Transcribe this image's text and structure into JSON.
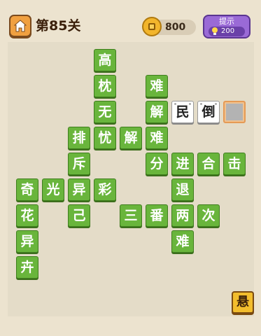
{
  "header": {
    "level_title": "第85关",
    "coins": "800",
    "hint_label": "提示",
    "hint_count": "200"
  },
  "board": {
    "tiles": [
      {
        "char": "高",
        "style": "green"
      },
      {
        "char": "枕",
        "style": "green"
      },
      {
        "char": "难",
        "style": "green"
      },
      {
        "char": "无",
        "style": "green"
      },
      {
        "char": "解",
        "style": "green"
      },
      {
        "char": "民",
        "style": "white"
      },
      {
        "char": "倒",
        "style": "white"
      },
      {
        "char": "",
        "style": "blank"
      },
      {
        "char": "排",
        "style": "green"
      },
      {
        "char": "忧",
        "style": "green"
      },
      {
        "char": "解",
        "style": "green"
      },
      {
        "char": "难",
        "style": "green"
      },
      {
        "char": "斥",
        "style": "green"
      },
      {
        "char": "分",
        "style": "green"
      },
      {
        "char": "进",
        "style": "green"
      },
      {
        "char": "合",
        "style": "green"
      },
      {
        "char": "击",
        "style": "green"
      },
      {
        "char": "奇",
        "style": "green"
      },
      {
        "char": "光",
        "style": "green"
      },
      {
        "char": "异",
        "style": "green"
      },
      {
        "char": "彩",
        "style": "green"
      },
      {
        "char": "退",
        "style": "green"
      },
      {
        "char": "花",
        "style": "green"
      },
      {
        "char": "己",
        "style": "green"
      },
      {
        "char": "三",
        "style": "green"
      },
      {
        "char": "番",
        "style": "green"
      },
      {
        "char": "两",
        "style": "green"
      },
      {
        "char": "次",
        "style": "green"
      },
      {
        "char": "异",
        "style": "green"
      },
      {
        "char": "难",
        "style": "green"
      },
      {
        "char": "卉",
        "style": "green"
      }
    ]
  },
  "footer": {
    "hang_label": "悬"
  },
  "colors": {
    "background": "#ece3cf",
    "tile_green": "#69b53c",
    "hint_purple": "#9a6ad6",
    "coin_gold": "#f2b52c",
    "home_orange": "#f0a040"
  },
  "icons": {
    "home": "house-icon",
    "coin": "coin-icon",
    "hint": "lightbulb-icon"
  }
}
